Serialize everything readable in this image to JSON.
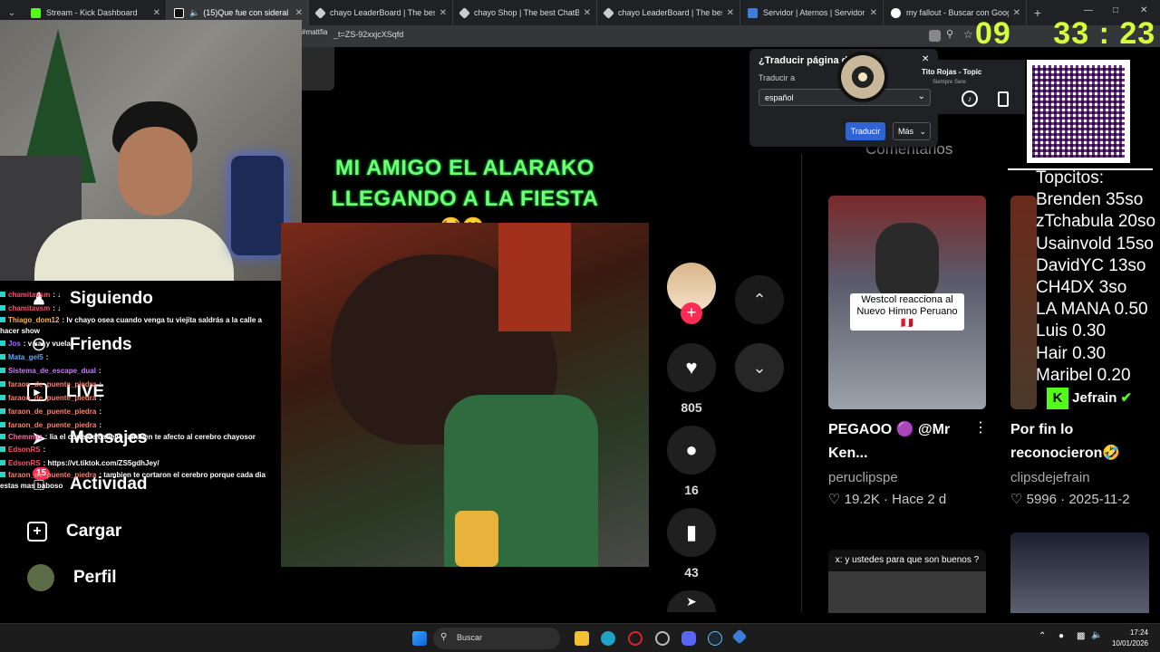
{
  "browser": {
    "tabs": [
      {
        "title": "Stream - Kick Dashboard",
        "color": "#53fc18"
      },
      {
        "title": "(15)Que fue con sideral",
        "color": "#ffffff"
      },
      {
        "title": "chayo LeaderBoard | The best Chat",
        "color": "#cccccc"
      },
      {
        "title": "chayo Shop | The best ChatBot an",
        "color": "#cccccc"
      },
      {
        "title": "chayo LeaderBoard | The best Chat",
        "color": "#cccccc"
      },
      {
        "title": "Servidor | Aternos | Servidor de M",
        "color": "#3b7dd8"
      },
      {
        "title": "my fallout - Buscar con Google",
        "color": "#4285f4"
      }
    ],
    "url": "_t=ZS-92xxjcXSqfd"
  },
  "sidebar": {
    "items": [
      {
        "label": "Siguiendo",
        "icon": "following-icon"
      },
      {
        "label": "Friends",
        "icon": "friends-icon"
      },
      {
        "label": "LIVE",
        "icon": "live-icon"
      },
      {
        "label": "Mensajes",
        "icon": "messages-icon"
      },
      {
        "label": "Actividad",
        "icon": "activity-icon"
      },
      {
        "label": "Cargar",
        "icon": "upload-icon"
      },
      {
        "label": "Perfil",
        "icon": "profile-avatar"
      }
    ],
    "activity_badge": "15"
  },
  "chat": [
    {
      "user": "chamitavsm",
      "msg": "↓",
      "color": "#ff4d6a"
    },
    {
      "user": "chamitavsm",
      "msg": "↓",
      "color": "#ff4d6a"
    },
    {
      "user": "Thiago_dom12",
      "msg": "lv chayo osea cuando venga tu viejita saldrás a la calle a hacer show",
      "color": "#ffb347"
    },
    {
      "user": "Jos",
      "msg": "v sal y vuela",
      "color": "#a86bff"
    },
    {
      "user": "Mata_gel5",
      "msg": "",
      "color": "#5fa8ff"
    },
    {
      "user": "Sistema_de_escape_dual",
      "msg": "",
      "color": "#c57cff"
    },
    {
      "user": "faraon_de_puente_piedra",
      "msg": "",
      "color": "#ff7f6b"
    },
    {
      "user": "faraon_de_puente_piedra",
      "msg": "",
      "color": "#ff7f6b"
    },
    {
      "user": "faraon_de_puente_piedra",
      "msg": "",
      "color": "#ff7f6b"
    },
    {
      "user": "faraon_de_puente_piedra",
      "msg": "",
      "color": "#ff7f6b"
    },
    {
      "user": "Chemmaz",
      "msg": "lia el corte de cabello tambien te afecto al cerebro chayosor",
      "color": "#ff66aa"
    },
    {
      "user": "EdsonRS",
      "msg": "",
      "color": "#ff4d6a"
    },
    {
      "user": "EdsonRS",
      "msg": "https://vt.tiktok.com/ZS5gdhJey/",
      "color": "#ff4d6a"
    },
    {
      "user": "faraon_de_puente_piedra",
      "msg": "tambien te cortaron el cerebro porque cada dia estas mas baboso",
      "color": "#ff7f6b"
    }
  ],
  "video": {
    "caption_line1": "MI AMIGO EL ALARAKO",
    "caption_line2": "LLEGANDO A LA FIESTA",
    "caption_emoji": "😂🤭",
    "likes": "805",
    "comments": "16",
    "saves": "43"
  },
  "right_panel": {
    "tab_comments": "Comentarios",
    "cards": [
      {
        "title": "PEGAOO 🟣 @Mr Ken...",
        "author": "peruclipspe",
        "likes": "19.2K",
        "date": "Hace 2 d",
        "overlay": "Westcol reacciona al Nuevo Himno Peruano🇵🇪"
      },
      {
        "title": "Por fin lo reconocieron🤣",
        "author": "clipsdejefrain",
        "likes": "5996",
        "date": "2025-11-2",
        "overlay": ""
      }
    ],
    "card3_caption": "x: y ustedes para que son buenos ?"
  },
  "translate_popup": {
    "title": "¿Traducir página de",
    "label": "Traducir a",
    "selected": "español",
    "translate_button": "Traducir",
    "more_button": "Más"
  },
  "music": {
    "title": "Tito Rojas - Topic",
    "subtitle": "Siempre Sere"
  },
  "clock_overlay": {
    "hours": "09",
    "minutes": "33",
    "seconds": "23"
  },
  "topcitos": {
    "title": "Topcitos:",
    "entries": [
      "Brenden 35so",
      "zTchabula 20so",
      "Usainvold 15so",
      "DavidYC 13so",
      "CH4DX 3so",
      "LA MANA 0.50",
      "Luis 0.30",
      "Hair 0.30",
      "Maribel 0.20"
    ]
  },
  "kick_badge": "Jefrain",
  "taskbar": {
    "search_placeholder": "Buscar",
    "time": "17:24",
    "date": "10/01/2026"
  }
}
